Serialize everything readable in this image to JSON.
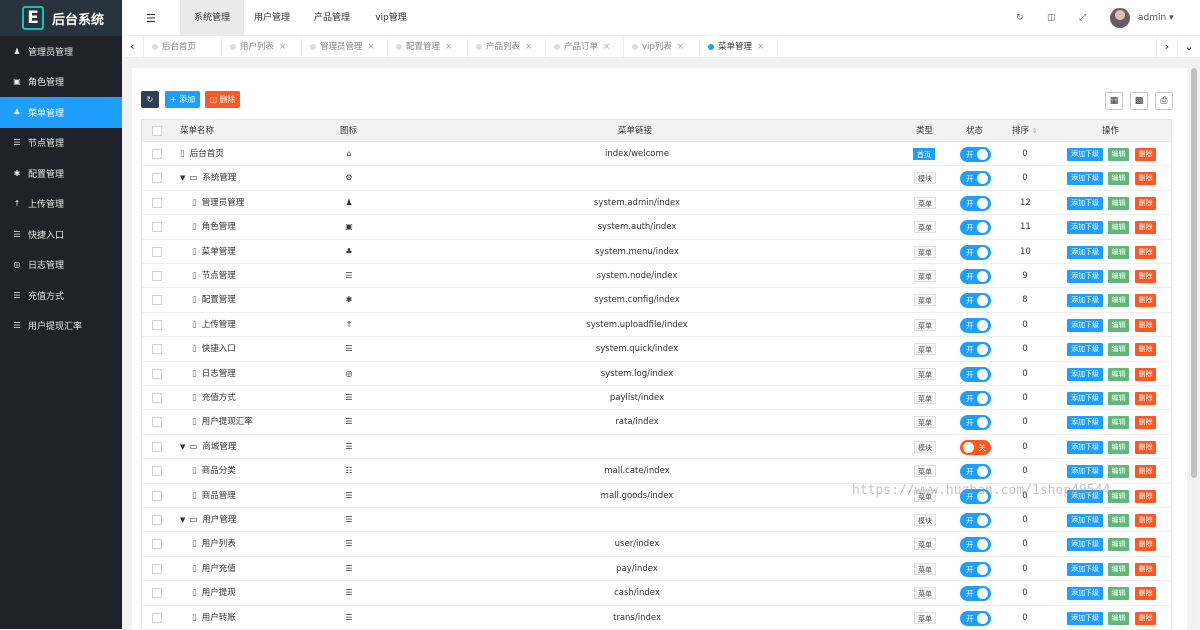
{
  "logo": {
    "letter": "E",
    "title": "后台系统"
  },
  "sidebar": {
    "items": [
      {
        "label": "管理员管理",
        "icon": "user-icon",
        "glyph": "♟"
      },
      {
        "label": "角色管理",
        "icon": "shield-icon",
        "glyph": "▣"
      },
      {
        "label": "菜单管理",
        "icon": "tree-icon",
        "glyph": "♣",
        "active": true
      },
      {
        "label": "节点管理",
        "icon": "list-icon",
        "glyph": "☰"
      },
      {
        "label": "配置管理",
        "icon": "asterisk-icon",
        "glyph": "✱"
      },
      {
        "label": "上传管理",
        "icon": "arrow-up-icon",
        "glyph": "↑"
      },
      {
        "label": "快捷入口",
        "icon": "list-icon",
        "glyph": "☰"
      },
      {
        "label": "日志管理",
        "icon": "globe-icon",
        "glyph": "◎"
      },
      {
        "label": "充值方式",
        "icon": "list-icon",
        "glyph": "☰"
      },
      {
        "label": "用户提现汇率",
        "icon": "list-icon",
        "glyph": "☰"
      }
    ]
  },
  "header": {
    "top_tabs": [
      "系统管理",
      "用户管理",
      "产品管理",
      "vip管理"
    ],
    "user": "admin"
  },
  "page_tabs": [
    "后台首页",
    "用户列表",
    "管理员管理",
    "配置管理",
    "产品列表",
    "产品订单",
    "vip列表",
    "菜单管理"
  ],
  "toolbar": {
    "add_label": "添加",
    "delete_label": "删除"
  },
  "table": {
    "headers": {
      "name": "菜单名称",
      "icon": "图标",
      "href": "菜单链接",
      "type": "类型",
      "status": "状态",
      "sort": "排序",
      "ops": "操作"
    },
    "op_labels": {
      "add": "添加下级",
      "edit": "编辑",
      "del": "删除"
    },
    "status_labels": {
      "on": "开",
      "off": "关"
    },
    "rows": [
      {
        "name": "后台首页",
        "level": 0,
        "kind": "page",
        "icon": "home-icon",
        "glyph": "⌂",
        "href": "index/welcome",
        "type": "首页",
        "type_style": "blue",
        "status": "on",
        "sort": "0"
      },
      {
        "name": "系统管理",
        "level": 0,
        "kind": "folder",
        "icon": "gear-icon",
        "glyph": "⚙",
        "href": "",
        "type": "模块",
        "type_style": "gray",
        "status": "on",
        "sort": "0"
      },
      {
        "name": "管理员管理",
        "level": 1,
        "kind": "page",
        "icon": "user-icon",
        "glyph": "♟",
        "href": "system.admin/index",
        "type": "菜单",
        "type_style": "gray",
        "status": "on",
        "sort": "12"
      },
      {
        "name": "角色管理",
        "level": 1,
        "kind": "page",
        "icon": "shield-icon",
        "glyph": "▣",
        "href": "system.auth/index",
        "type": "菜单",
        "type_style": "gray",
        "status": "on",
        "sort": "11"
      },
      {
        "name": "菜单管理",
        "level": 1,
        "kind": "page",
        "icon": "tree-icon",
        "glyph": "♣",
        "href": "system.menu/index",
        "type": "菜单",
        "type_style": "gray",
        "status": "on",
        "sort": "10"
      },
      {
        "name": "节点管理",
        "level": 1,
        "kind": "page",
        "icon": "list-icon",
        "glyph": "☰",
        "href": "system.node/index",
        "type": "菜单",
        "type_style": "gray",
        "status": "on",
        "sort": "9"
      },
      {
        "name": "配置管理",
        "level": 1,
        "kind": "page",
        "icon": "asterisk-icon",
        "glyph": "✱",
        "href": "system.config/index",
        "type": "菜单",
        "type_style": "gray",
        "status": "on",
        "sort": "8"
      },
      {
        "name": "上传管理",
        "level": 1,
        "kind": "page",
        "icon": "arrow-up-icon",
        "glyph": "↑",
        "href": "system.uploadfile/index",
        "type": "菜单",
        "type_style": "gray",
        "status": "on",
        "sort": "0"
      },
      {
        "name": "快捷入口",
        "level": 1,
        "kind": "page",
        "icon": "list-icon",
        "glyph": "☰",
        "href": "system.quick/index",
        "type": "菜单",
        "type_style": "gray",
        "status": "on",
        "sort": "0"
      },
      {
        "name": "日志管理",
        "level": 1,
        "kind": "page",
        "icon": "globe-icon",
        "glyph": "◎",
        "href": "system.log/index",
        "type": "菜单",
        "type_style": "gray",
        "status": "on",
        "sort": "0"
      },
      {
        "name": "充值方式",
        "level": 1,
        "kind": "page",
        "icon": "list-icon",
        "glyph": "☰",
        "href": "paylist/index",
        "type": "菜单",
        "type_style": "gray",
        "status": "on",
        "sort": "0"
      },
      {
        "name": "用户提现汇率",
        "level": 1,
        "kind": "page",
        "icon": "list-icon",
        "glyph": "☰",
        "href": "rata/index",
        "type": "菜单",
        "type_style": "gray",
        "status": "on",
        "sort": "0"
      },
      {
        "name": "商城管理",
        "level": 0,
        "kind": "folder",
        "icon": "list-icon",
        "glyph": "☰",
        "href": "",
        "type": "模块",
        "type_style": "gray",
        "status": "off",
        "sort": "0"
      },
      {
        "name": "商品分类",
        "level": 1,
        "kind": "page",
        "icon": "calendar-icon",
        "glyph": "☷",
        "href": "mall.cate/index",
        "type": "菜单",
        "type_style": "gray",
        "status": "on",
        "sort": "0"
      },
      {
        "name": "商品管理",
        "level": 1,
        "kind": "page",
        "icon": "list-icon",
        "glyph": "☰",
        "href": "mall.goods/index",
        "type": "菜单",
        "type_style": "gray",
        "status": "on",
        "sort": "0"
      },
      {
        "name": "用户管理",
        "level": 0,
        "kind": "folder",
        "icon": "list-icon",
        "glyph": "☰",
        "href": "",
        "type": "模块",
        "type_style": "gray",
        "status": "on",
        "sort": "0"
      },
      {
        "name": "用户列表",
        "level": 1,
        "kind": "page",
        "icon": "list-icon",
        "glyph": "☰",
        "href": "user/index",
        "type": "菜单",
        "type_style": "gray",
        "status": "on",
        "sort": "0"
      },
      {
        "name": "用户充值",
        "level": 1,
        "kind": "page",
        "icon": "list-icon",
        "glyph": "☰",
        "href": "pay/index",
        "type": "菜单",
        "type_style": "gray",
        "status": "on",
        "sort": "0"
      },
      {
        "name": "用户提现",
        "level": 1,
        "kind": "page",
        "icon": "list-icon",
        "glyph": "☰",
        "href": "cash/index",
        "type": "菜单",
        "type_style": "gray",
        "status": "on",
        "sort": "0"
      },
      {
        "name": "用户转账",
        "level": 1,
        "kind": "page",
        "icon": "list-icon",
        "glyph": "☰",
        "href": "trans/index",
        "type": "菜单",
        "type_style": "gray",
        "status": "on",
        "sort": "0"
      }
    ]
  },
  "watermark": "https://www.huzhan.com/1shop49544"
}
